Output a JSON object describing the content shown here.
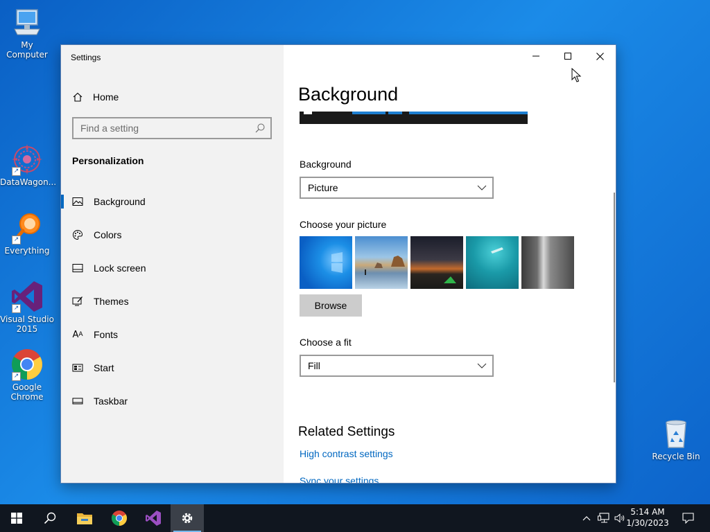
{
  "desktop": {
    "icons": [
      {
        "label": "My Computer"
      },
      {
        "label": "DataWagon..."
      },
      {
        "label": "Everything"
      },
      {
        "label": "Visual Studio 2015"
      },
      {
        "label": "Google Chrome"
      },
      {
        "label": "Recycle Bin"
      }
    ]
  },
  "window": {
    "title": "Settings",
    "caption_buttons": [
      "minimize",
      "maximize",
      "close"
    ]
  },
  "nav": {
    "home_label": "Home",
    "search_placeholder": "Find a setting",
    "section_title": "Personalization",
    "items": [
      {
        "label": "Background",
        "icon": "picture-icon",
        "active": true
      },
      {
        "label": "Colors",
        "icon": "palette-icon"
      },
      {
        "label": "Lock screen",
        "icon": "lock-screen-icon"
      },
      {
        "label": "Themes",
        "icon": "themes-icon"
      },
      {
        "label": "Fonts",
        "icon": "fonts-icon"
      },
      {
        "label": "Start",
        "icon": "start-icon"
      },
      {
        "label": "Taskbar",
        "icon": "taskbar-icon"
      }
    ]
  },
  "content": {
    "page_title": "Background",
    "background_label": "Background",
    "background_value": "Picture",
    "choose_picture_label": "Choose your picture",
    "thumbnails": [
      "windows-blue",
      "beach-rocks",
      "night-sky-tent",
      "underwater-swimmer",
      "waterfall-cliff"
    ],
    "browse_label": "Browse",
    "fit_label": "Choose a fit",
    "fit_value": "Fill",
    "related_title": "Related Settings",
    "links": [
      "High contrast settings",
      "Sync your settings"
    ]
  },
  "taskbar": {
    "apps": [
      "start-icon",
      "search-icon",
      "file-explorer-icon",
      "chrome-icon",
      "visual-studio-icon",
      "settings-icon"
    ],
    "active_app": "settings-icon",
    "time": "5:14 AM",
    "date": "1/30/2023"
  },
  "colors": {
    "accent": "#0067c0",
    "nav_bg": "#f2f2f2",
    "taskbar_bg": "#10161f"
  }
}
